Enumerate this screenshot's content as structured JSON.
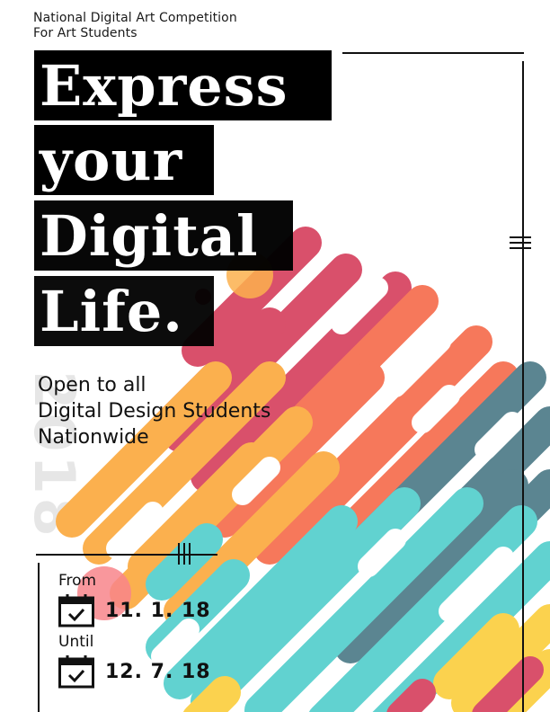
{
  "header": {
    "line1": "National Digital Art Competition",
    "line2": "For Art Students"
  },
  "headline": {
    "line1": "Express",
    "line2": "your",
    "line3": "Digital",
    "line4": "Life."
  },
  "year_watermark": "2018",
  "eligibility": {
    "line1": "Open to all",
    "line2": "Digital Design Students",
    "line3": "Nationwide"
  },
  "dates": {
    "from_label": "From",
    "from_value": "11. 1. 18",
    "until_label": "Until",
    "until_value": "12. 7. 18",
    "calendar_icon": "calendar-check-icon"
  },
  "colors": {
    "crimson": "#d9506b",
    "coral": "#f6785b",
    "orange": "#fbb04e",
    "teal": "#5b8591",
    "aqua": "#61d2d0",
    "yellow": "#fbd24e",
    "accent_dot": "#c0393f"
  }
}
